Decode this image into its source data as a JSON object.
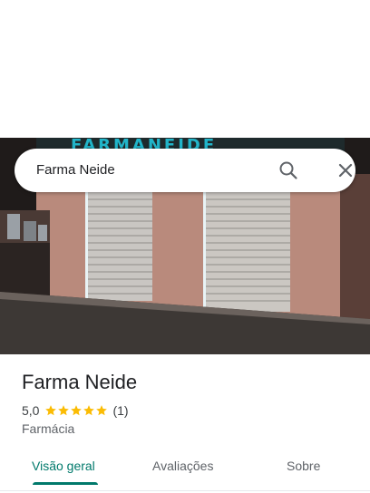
{
  "search": {
    "query": "Farma Neide"
  },
  "hero": {
    "sign_text": "FARMANEIDE"
  },
  "place": {
    "name": "Farma Neide",
    "rating": "5,0",
    "stars": 5,
    "review_count": "(1)",
    "category": "Farmácia"
  },
  "tabs": [
    {
      "label": "Visão geral",
      "active": true
    },
    {
      "label": "Avaliações",
      "active": false
    },
    {
      "label": "Sobre",
      "active": false
    }
  ],
  "colors": {
    "accent": "#00796b",
    "star": "#fbbc04",
    "sign": "#21b5c9"
  }
}
